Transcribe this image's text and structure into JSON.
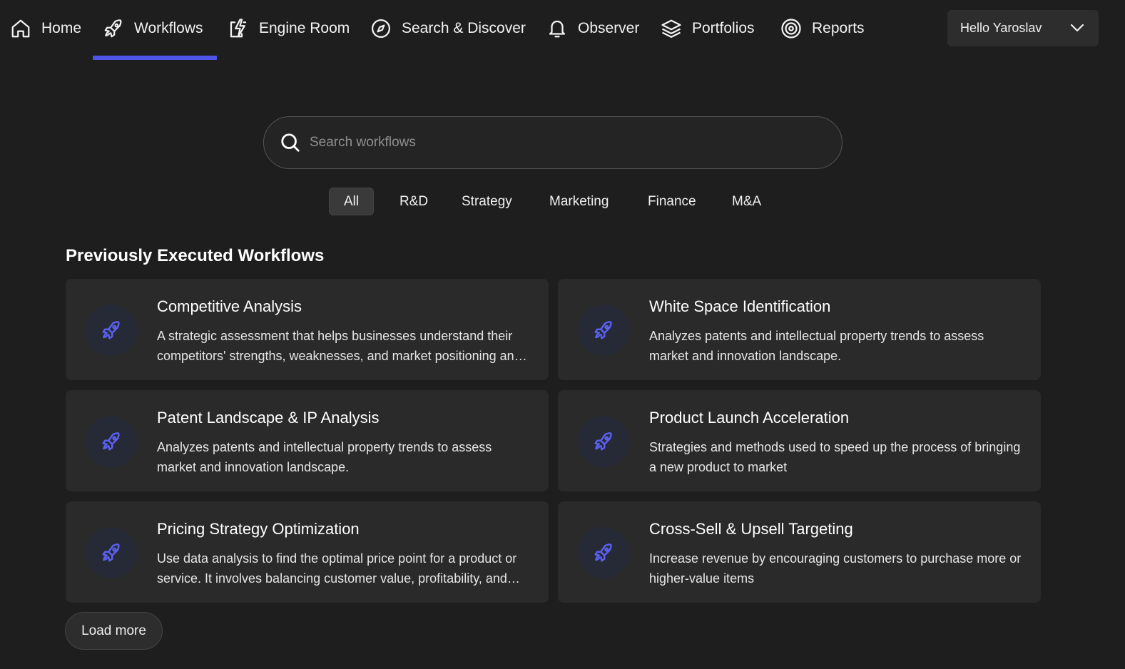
{
  "nav": {
    "items": [
      {
        "label": "Home",
        "icon": "home-icon"
      },
      {
        "label": "Workflows",
        "icon": "rocket-icon",
        "active": true
      },
      {
        "label": "Engine Room",
        "icon": "lightning-icon"
      },
      {
        "label": "Search & Discover",
        "icon": "compass-icon"
      },
      {
        "label": "Observer",
        "icon": "bell-icon"
      },
      {
        "label": "Portfolios",
        "icon": "layers-icon"
      },
      {
        "label": "Reports",
        "icon": "target-icon"
      }
    ],
    "user_greeting": "Hello Yaroslav"
  },
  "search": {
    "placeholder": "Search workflows",
    "value": ""
  },
  "filters": [
    "All",
    "R&D",
    "Strategy",
    "Marketing",
    "Finance",
    "M&A"
  ],
  "active_filter": "All",
  "section": {
    "title": "Previously Executed Workflows"
  },
  "workflows": [
    {
      "title": "Competitive Analysis",
      "description": "A strategic assessment that helps businesses understand their competitors' strengths, weaknesses, and market positioning and opportunities."
    },
    {
      "title": "White Space Identification",
      "description": "Analyzes patents and intellectual property trends to assess market and innovation landscape."
    },
    {
      "title": "Patent Landscape & IP Analysis",
      "description": "Analyzes patents and intellectual property trends to assess market and innovation landscape."
    },
    {
      "title": "Product Launch Acceleration",
      "description": "Strategies and methods used to speed up the process of bringing a new product to market"
    },
    {
      "title": "Pricing Strategy Optimization",
      "description": "Use data analysis to find the optimal price point for a product or service. It involves balancing customer value, profitability, and competition."
    },
    {
      "title": "Cross-Sell & Upsell Targeting",
      "description": "Increase revenue by encouraging customers to purchase more or higher-value items"
    }
  ],
  "load_more_label": "Load more",
  "colors": {
    "background": "#1e1e1e",
    "card": "#2a2a2a",
    "accent": "#4f55e8",
    "icon_circle": "#252a36"
  }
}
